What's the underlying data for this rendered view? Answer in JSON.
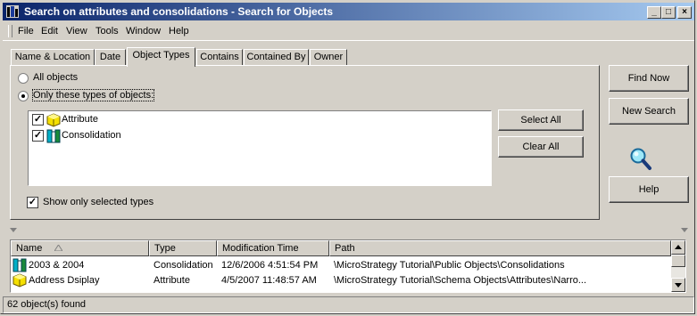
{
  "window": {
    "title": "Search on attributes and consolidations - Search for Objects",
    "controls": {
      "minimize": "_",
      "maximize": "□",
      "close": "×"
    }
  },
  "menu": {
    "items": [
      "File",
      "Edit",
      "View",
      "Tools",
      "Window",
      "Help"
    ]
  },
  "tabs": [
    "Name & Location",
    "Date",
    "Object Types",
    "Contains",
    "Contained By",
    "Owner"
  ],
  "active_tab": "Object Types",
  "object_types": {
    "radio_all": "All objects",
    "radio_only": "Only these types of objects:",
    "selected_radio": "only",
    "types": [
      {
        "label": "Attribute",
        "checked": true,
        "icon": "attribute-icon"
      },
      {
        "label": "Consolidation",
        "checked": true,
        "icon": "consolidation-icon"
      }
    ],
    "select_all": "Select All",
    "clear_all": "Clear All",
    "show_only_selected": "Show only selected types",
    "show_only_selected_checked": true
  },
  "actions": {
    "find_now": "Find Now",
    "new_search": "New Search",
    "help": "Help",
    "search_icon": "magnifier-icon"
  },
  "results": {
    "columns": [
      "Name",
      "Type",
      "Modification Time",
      "Path"
    ],
    "rows": [
      {
        "name": "2003 & 2004",
        "type": "Consolidation",
        "modified": "12/6/2006 4:51:54 PM",
        "path": "\\MicroStrategy Tutorial\\Public Objects\\Consolidations",
        "icon": "consolidation-icon"
      },
      {
        "name": "Address Dsiplay",
        "type": "Attribute",
        "modified": "4/5/2007 11:48:57 AM",
        "path": "\\MicroStrategy Tutorial\\Schema Objects\\Attributes\\Narro...",
        "icon": "attribute-icon"
      }
    ]
  },
  "status": "62 object(s) found",
  "colors": {
    "titlebar_start": "#0a246a",
    "titlebar_end": "#a6caf0",
    "face": "#d4d0c8"
  }
}
